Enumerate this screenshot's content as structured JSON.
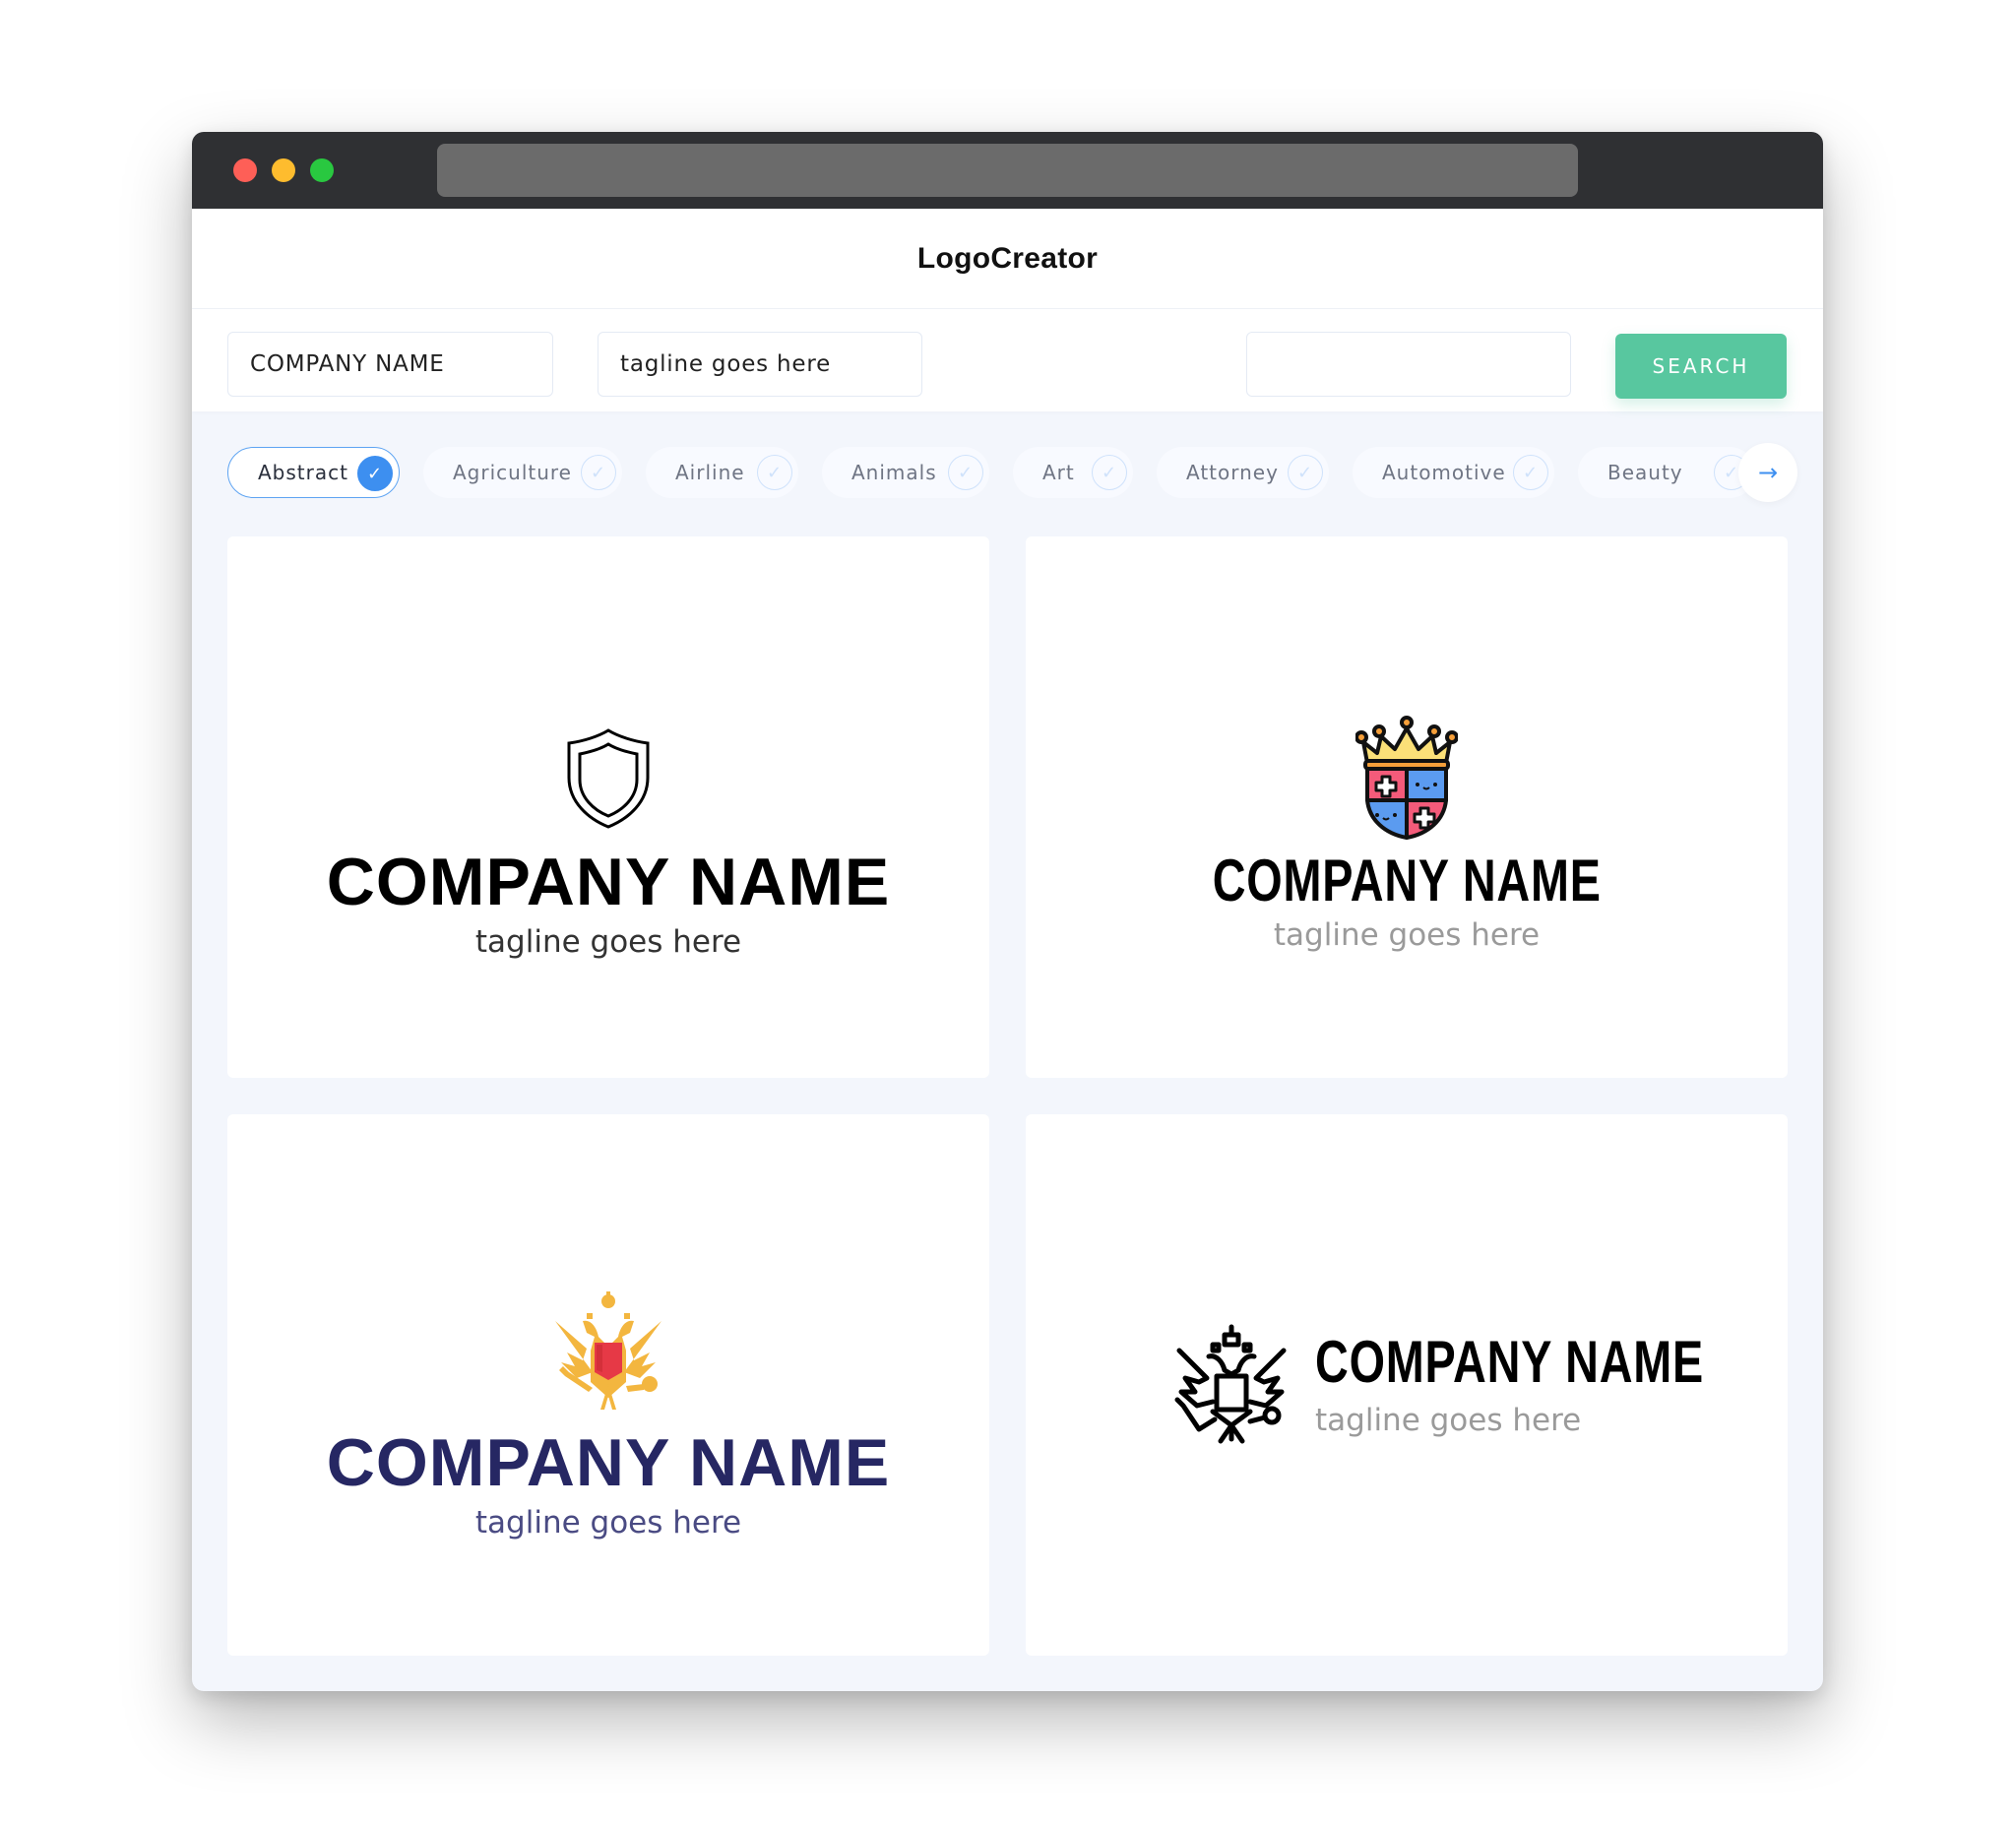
{
  "window": {
    "url": ""
  },
  "header": {
    "title": "LogoCreator"
  },
  "toolbar": {
    "company_value": "COMPANY NAME",
    "tagline_value": "tagline goes here",
    "keyword_value": "",
    "search_label": "SEARCH"
  },
  "categories": [
    {
      "label": "Abstract",
      "selected": true
    },
    {
      "label": "Agriculture",
      "selected": false
    },
    {
      "label": "Airline",
      "selected": false
    },
    {
      "label": "Animals",
      "selected": false
    },
    {
      "label": "Art",
      "selected": false
    },
    {
      "label": "Attorney",
      "selected": false
    },
    {
      "label": "Automotive",
      "selected": false
    },
    {
      "label": "Beauty",
      "selected": false
    }
  ],
  "icons": {
    "check": "✓",
    "next_arrow": "→"
  },
  "logos": [
    {
      "icon": "shield-outline",
      "company": "COMPANY NAME",
      "tagline": "tagline goes here",
      "name_color": "#000000",
      "tagline_color": "#333333"
    },
    {
      "icon": "crowned-crest",
      "company": "COMPANY NAME",
      "tagline": "tagline goes here",
      "name_color": "#000000",
      "tagline_color": "#9a9a9a"
    },
    {
      "icon": "double-headed-eagle-gold",
      "company": "COMPANY NAME",
      "tagline": "tagline goes here",
      "name_color": "#262763",
      "tagline_color": "#4a4b83"
    },
    {
      "icon": "double-headed-eagle-outline",
      "company": "COMPANY NAME",
      "tagline": "tagline goes here",
      "name_color": "#000000",
      "tagline_color": "#9a9a9a"
    }
  ],
  "colors": {
    "accent_green": "#58c79f",
    "accent_blue": "#3d8ff0",
    "background": "#f3f6fc"
  }
}
